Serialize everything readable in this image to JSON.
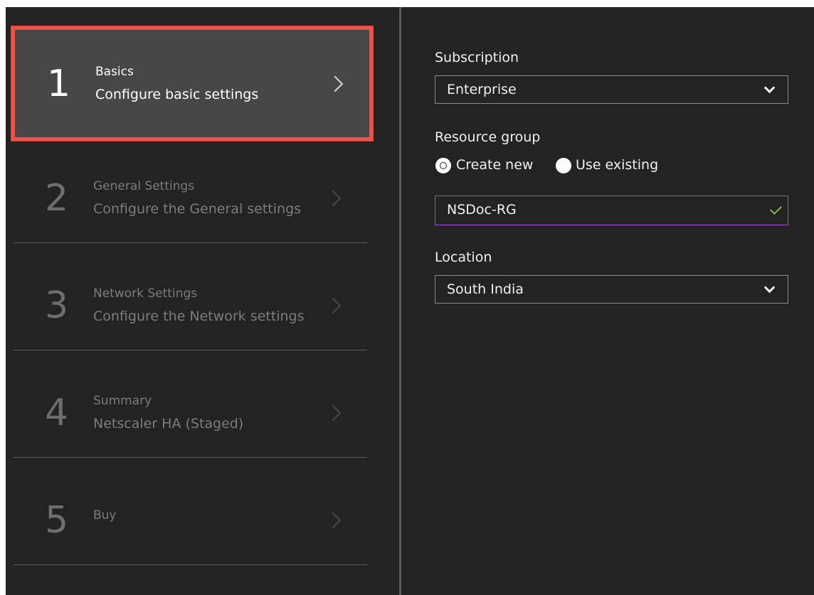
{
  "steps": [
    {
      "number": "1",
      "title": "Basics",
      "subtitle": "Configure basic settings",
      "active": true
    },
    {
      "number": "2",
      "title": "General Settings",
      "subtitle": "Configure the General settings",
      "active": false
    },
    {
      "number": "3",
      "title": "Network Settings",
      "subtitle": "Configure the Network settings",
      "active": false
    },
    {
      "number": "4",
      "title": "Summary",
      "subtitle": "Netscaler HA (Staged)",
      "active": false
    },
    {
      "number": "5",
      "title": "Buy",
      "subtitle": "",
      "active": false
    }
  ],
  "form": {
    "subscription": {
      "label": "Subscription",
      "value": "Enterprise"
    },
    "resource_group": {
      "label": "Resource group",
      "options": [
        {
          "label": "Create new",
          "selected": true
        },
        {
          "label": "Use existing",
          "selected": false
        }
      ],
      "value": "NSDoc-RG",
      "valid": true
    },
    "location": {
      "label": "Location",
      "value": "South India"
    }
  },
  "colors": {
    "background": "#232323",
    "active_step_bg": "#474747",
    "highlight_border": "#f05247",
    "input_focus_border": "#9b4fd0",
    "valid_check": "#7bc043"
  }
}
